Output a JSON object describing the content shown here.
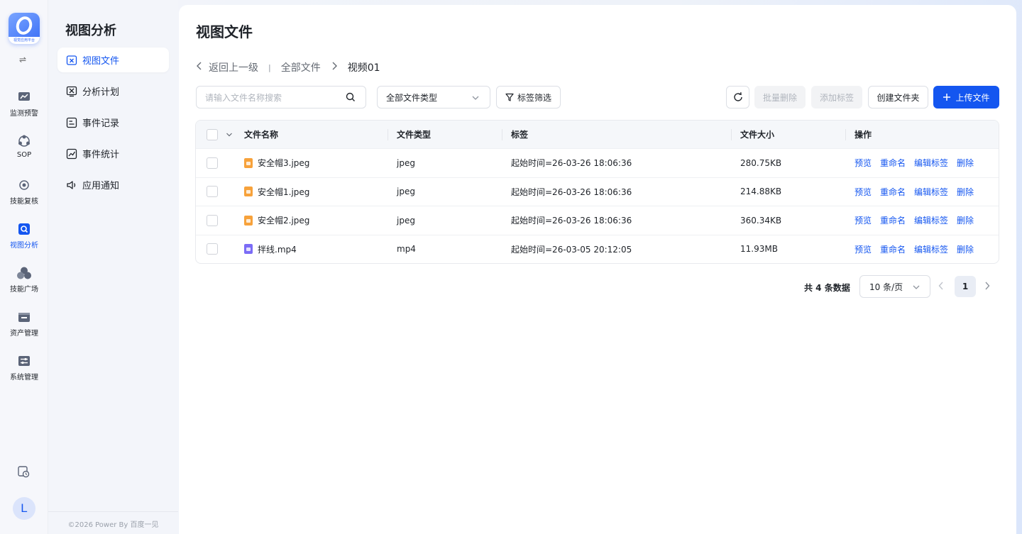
{
  "app": {
    "logo_caption": "视觉应用平台",
    "rail": [
      {
        "label": "监测预警",
        "icon": "monitor-chart-icon"
      },
      {
        "label": "SOP",
        "icon": "sop-cluster-icon"
      },
      {
        "label": "技能复核",
        "icon": "target-icon"
      },
      {
        "label": "视图分析",
        "icon": "view-search-icon",
        "active": true
      },
      {
        "label": "技能广场",
        "icon": "circles-icon"
      },
      {
        "label": "资产管理",
        "icon": "asset-box-icon"
      },
      {
        "label": "系统管理",
        "icon": "system-sliders-icon"
      }
    ],
    "avatar_letter": "L"
  },
  "submenu": {
    "title": "视图分析",
    "items": [
      {
        "label": "视图文件",
        "icon": "view-file-icon",
        "active": true
      },
      {
        "label": "分析计划",
        "icon": "analysis-plan-icon"
      },
      {
        "label": "事件记录",
        "icon": "event-record-icon"
      },
      {
        "label": "事件统计",
        "icon": "event-stats-icon"
      },
      {
        "label": "应用通知",
        "icon": "speaker-icon"
      }
    ],
    "copyright": "©2026 Power By 百度一见"
  },
  "main": {
    "title": "视图文件",
    "breadcrumb": {
      "back": "返回上一级",
      "root": "全部文件",
      "current": "视频01"
    },
    "search": {
      "placeholder": "请输入文件名称搜索"
    },
    "type_select": {
      "value": "全部文件类型"
    },
    "tag_filter": "标签筛选",
    "toolbar": {
      "batch_delete": "批量删除",
      "add_tag": "添加标签",
      "create_folder": "创建文件夹",
      "upload": "上传文件"
    },
    "table": {
      "columns": [
        "文件名称",
        "文件类型",
        "标签",
        "文件大小",
        "操作"
      ],
      "actions": [
        "预览",
        "重命名",
        "编辑标签",
        "删除"
      ],
      "rows": [
        {
          "name": "安全帽3.jpeg",
          "type": "jpeg",
          "tag": "起始时间=26-03-26 18:06:36",
          "size": "280.75KB",
          "kind": "img"
        },
        {
          "name": "安全帽1.jpeg",
          "type": "jpeg",
          "tag": "起始时间=26-03-26 18:06:36",
          "size": "214.88KB",
          "kind": "img"
        },
        {
          "name": "安全帽2.jpeg",
          "type": "jpeg",
          "tag": "起始时间=26-03-26 18:06:36",
          "size": "360.34KB",
          "kind": "img"
        },
        {
          "name": "拌线.mp4",
          "type": "mp4",
          "tag": "起始时间=26-03-05 20:12:05",
          "size": "11.93MB",
          "kind": "vid"
        }
      ]
    },
    "pagination": {
      "total": "共 4 条数据",
      "page_size": "10 条/页",
      "current_page": "1"
    }
  }
}
